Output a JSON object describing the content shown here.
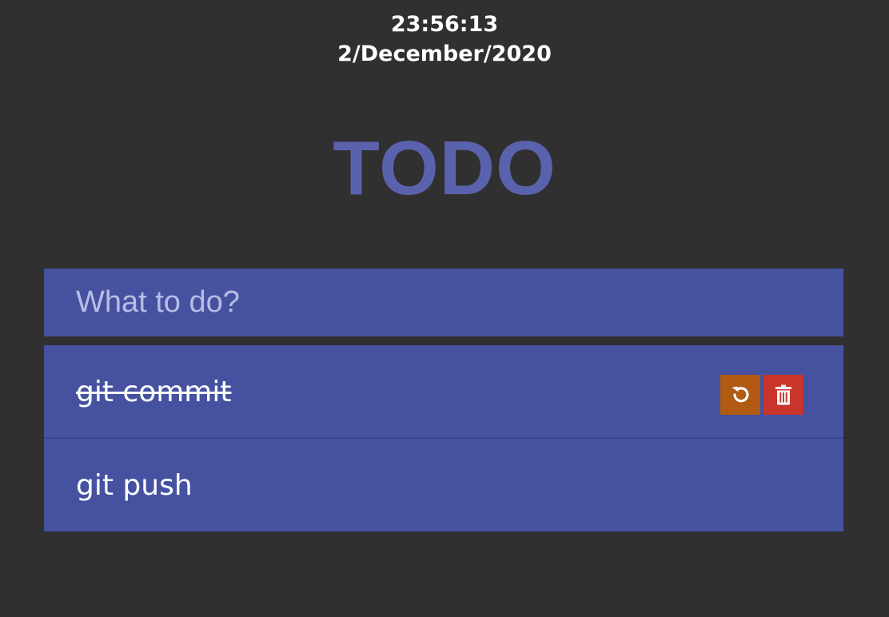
{
  "clock": {
    "time": "23:56:13",
    "date": "2/December/2020"
  },
  "title": "TODO",
  "new_todo": {
    "placeholder": "What to do?",
    "value": ""
  },
  "todos": [
    {
      "text": "git commit",
      "completed": true,
      "actions": [
        "undo-icon",
        "trash-icon"
      ]
    },
    {
      "text": "git push",
      "completed": false,
      "actions": []
    }
  ],
  "colors": {
    "background": "#303030",
    "title": "#5b62ad",
    "panel": "#4652a0",
    "undo_button": "#b05a12",
    "delete_button": "#c9352b"
  }
}
